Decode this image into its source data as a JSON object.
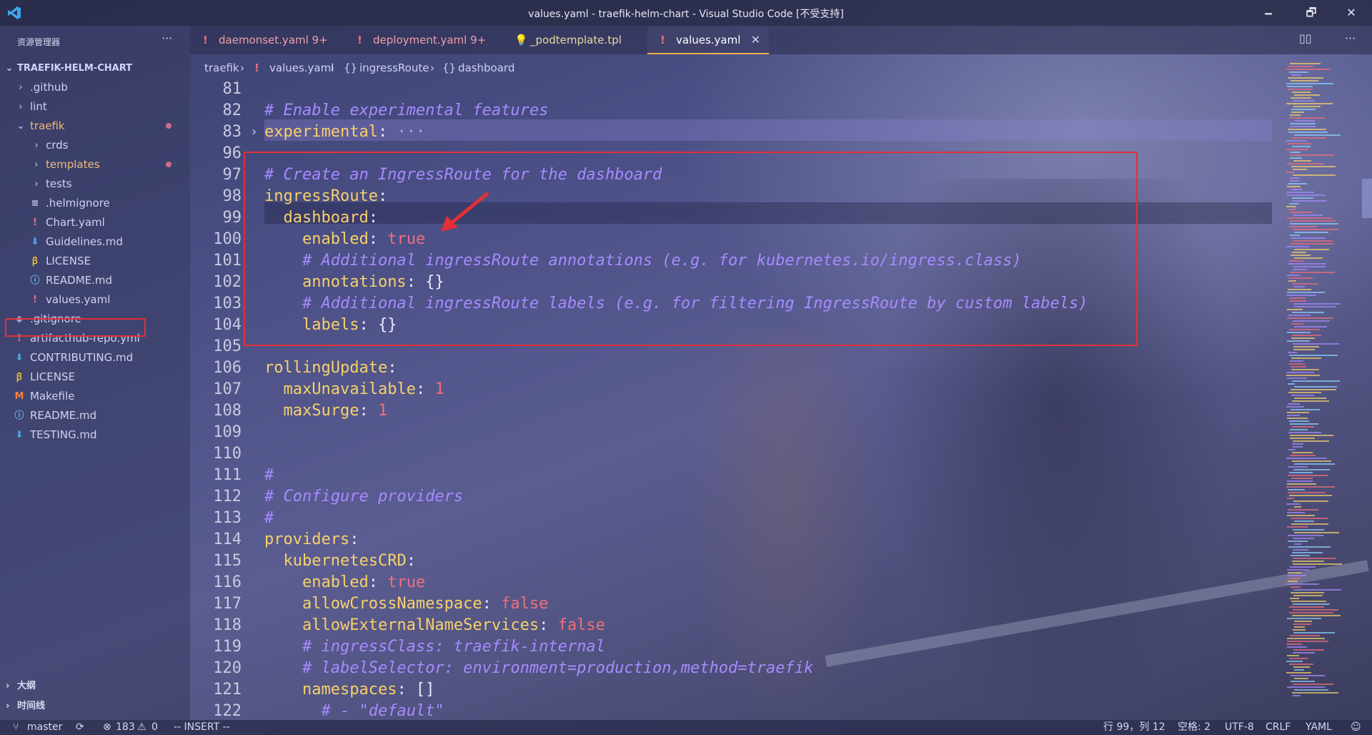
{
  "window": {
    "title": "values.yaml - traefik-helm-chart - Visual Studio Code [不受支持]",
    "minimize": "🗕",
    "restore": "🗗",
    "close": "✕"
  },
  "sidebar": {
    "header": "资源管理器",
    "more": "···",
    "root": "TRAEFIK-HELM-CHART",
    "items": [
      {
        "label": ".github",
        "type": "folder",
        "depth": 1,
        "expanded": false
      },
      {
        "label": "lint",
        "type": "folder",
        "depth": 1,
        "expanded": false
      },
      {
        "label": "traefik",
        "type": "folder",
        "depth": 1,
        "expanded": true,
        "modified": true
      },
      {
        "label": "crds",
        "type": "folder",
        "depth": 2,
        "expanded": false
      },
      {
        "label": "templates",
        "type": "folder",
        "depth": 2,
        "expanded": false,
        "modified": true
      },
      {
        "label": "tests",
        "type": "folder",
        "depth": 2,
        "expanded": false
      },
      {
        "label": ".helmignore",
        "type": "file",
        "icon": "≡",
        "depth": 2
      },
      {
        "label": "Chart.yaml",
        "type": "file",
        "icon": "!",
        "depth": 2
      },
      {
        "label": "Guidelines.md",
        "type": "file",
        "icon": "⬇",
        "depth": 2
      },
      {
        "label": "LICENSE",
        "type": "file",
        "icon": "ꞵ",
        "depth": 2
      },
      {
        "label": "README.md",
        "type": "file",
        "icon": "ⓘ",
        "depth": 2
      },
      {
        "label": "values.yaml",
        "type": "file",
        "icon": "!",
        "depth": 2,
        "selected": true
      },
      {
        "label": ".gitignore",
        "type": "file",
        "icon": "◆",
        "depth": 1
      },
      {
        "label": "artifacthub-repo.yml",
        "type": "file",
        "icon": "!",
        "depth": 1
      },
      {
        "label": "CONTRIBUTING.md",
        "type": "file",
        "icon": "⬇",
        "depth": 1
      },
      {
        "label": "LICENSE",
        "type": "file",
        "icon": "ꞵ",
        "depth": 1
      },
      {
        "label": "Makefile",
        "type": "file",
        "icon": "M",
        "depth": 1
      },
      {
        "label": "README.md",
        "type": "file",
        "icon": "ⓘ",
        "depth": 1
      },
      {
        "label": "TESTING.md",
        "type": "file",
        "icon": "⬇",
        "depth": 1
      }
    ],
    "outline": "大纲",
    "timeline": "时间线"
  },
  "tabs": [
    {
      "icon": "!",
      "label": "daemonset.yaml 9+"
    },
    {
      "icon": "!",
      "label": "deployment.yaml 9+"
    },
    {
      "icon": "💡",
      "label": "_podtemplate.tpl"
    },
    {
      "icon": "!",
      "label": "values.yaml",
      "active": true,
      "close": "✕"
    }
  ],
  "breadcrumb": {
    "items": [
      "traefik",
      "values.yaml",
      "ingressRoute",
      "dashboard"
    ],
    "sep": "›",
    "file_icon": "!",
    "obj_icon": "{}"
  },
  "editor": {
    "lines": [
      {
        "n": "81",
        "tokens": []
      },
      {
        "n": "82",
        "tokens": [
          [
            "c",
            "# Enable experimental features"
          ]
        ]
      },
      {
        "n": "83",
        "fold": true,
        "tokens": [
          [
            "k",
            "experimental"
          ],
          [
            "p",
            ": "
          ],
          [
            "fold",
            "···"
          ]
        ]
      },
      {
        "n": "96",
        "tokens": []
      },
      {
        "n": "97",
        "tokens": [
          [
            "c",
            "# Create an IngressRoute for the dashboard"
          ]
        ]
      },
      {
        "n": "98",
        "tokens": [
          [
            "k",
            "ingressRoute"
          ],
          [
            "p",
            ":"
          ]
        ]
      },
      {
        "n": "99",
        "tokens": [
          [
            "p",
            "  "
          ],
          [
            "k",
            "dashboard"
          ],
          [
            "p",
            ":"
          ]
        ]
      },
      {
        "n": "100",
        "tokens": [
          [
            "p",
            "    "
          ],
          [
            "k",
            "enabled"
          ],
          [
            "p",
            ": "
          ],
          [
            "s",
            "true"
          ]
        ]
      },
      {
        "n": "101",
        "tokens": [
          [
            "p",
            "    "
          ],
          [
            "c",
            "# Additional ingressRoute annotations (e.g. for kubernetes.io/ingress.class)"
          ]
        ]
      },
      {
        "n": "102",
        "tokens": [
          [
            "p",
            "    "
          ],
          [
            "k",
            "annotations"
          ],
          [
            "p",
            ": {}"
          ]
        ]
      },
      {
        "n": "103",
        "tokens": [
          [
            "p",
            "    "
          ],
          [
            "c",
            "# Additional ingressRoute labels (e.g. for filtering IngressRoute by custom labels)"
          ]
        ]
      },
      {
        "n": "104",
        "tokens": [
          [
            "p",
            "    "
          ],
          [
            "k",
            "labels"
          ],
          [
            "p",
            ": {}"
          ]
        ]
      },
      {
        "n": "105",
        "tokens": []
      },
      {
        "n": "106",
        "tokens": [
          [
            "k",
            "rollingUpdate"
          ],
          [
            "p",
            ":"
          ]
        ]
      },
      {
        "n": "107",
        "tokens": [
          [
            "p",
            "  "
          ],
          [
            "k",
            "maxUnavailable"
          ],
          [
            "p",
            ": "
          ],
          [
            "s",
            "1"
          ]
        ]
      },
      {
        "n": "108",
        "tokens": [
          [
            "p",
            "  "
          ],
          [
            "k",
            "maxSurge"
          ],
          [
            "p",
            ": "
          ],
          [
            "s",
            "1"
          ]
        ]
      },
      {
        "n": "109",
        "tokens": []
      },
      {
        "n": "110",
        "tokens": []
      },
      {
        "n": "111",
        "tokens": [
          [
            "c",
            "#"
          ]
        ]
      },
      {
        "n": "112",
        "tokens": [
          [
            "c",
            "# Configure providers"
          ]
        ]
      },
      {
        "n": "113",
        "tokens": [
          [
            "c",
            "#"
          ]
        ]
      },
      {
        "n": "114",
        "tokens": [
          [
            "k",
            "providers"
          ],
          [
            "p",
            ":"
          ]
        ]
      },
      {
        "n": "115",
        "tokens": [
          [
            "p",
            "  "
          ],
          [
            "k",
            "kubernetesCRD"
          ],
          [
            "p",
            ":"
          ]
        ]
      },
      {
        "n": "116",
        "tokens": [
          [
            "p",
            "    "
          ],
          [
            "k",
            "enabled"
          ],
          [
            "p",
            ": "
          ],
          [
            "s",
            "true"
          ]
        ]
      },
      {
        "n": "117",
        "tokens": [
          [
            "p",
            "    "
          ],
          [
            "k",
            "allowCrossNamespace"
          ],
          [
            "p",
            ": "
          ],
          [
            "s",
            "false"
          ]
        ]
      },
      {
        "n": "118",
        "tokens": [
          [
            "p",
            "    "
          ],
          [
            "k",
            "allowExternalNameServices"
          ],
          [
            "p",
            ": "
          ],
          [
            "s",
            "false"
          ]
        ]
      },
      {
        "n": "119",
        "tokens": [
          [
            "p",
            "    "
          ],
          [
            "c",
            "# ingressClass: traefik-internal"
          ]
        ]
      },
      {
        "n": "120",
        "tokens": [
          [
            "p",
            "    "
          ],
          [
            "c",
            "# labelSelector: environment=production,method=traefik"
          ]
        ]
      },
      {
        "n": "121",
        "tokens": [
          [
            "p",
            "    "
          ],
          [
            "k",
            "namespaces"
          ],
          [
            "p",
            ": []"
          ]
        ]
      },
      {
        "n": "122",
        "tokens": [
          [
            "p",
            "      "
          ],
          [
            "c",
            "# - \"default\""
          ]
        ]
      }
    ]
  },
  "statusbar": {
    "branch": "master",
    "sync": "⟳",
    "errors": "183",
    "warnings": "0",
    "mode": "-- INSERT --",
    "position": "行 99，列 12",
    "spaces": "空格: 2",
    "encoding": "UTF-8",
    "eol": "CRLF",
    "language": "YAML"
  },
  "colors": {
    "accent_red": "#e0303a",
    "key": "#f7d16a",
    "comment": "#a78bff",
    "value": "#f06e7c"
  }
}
